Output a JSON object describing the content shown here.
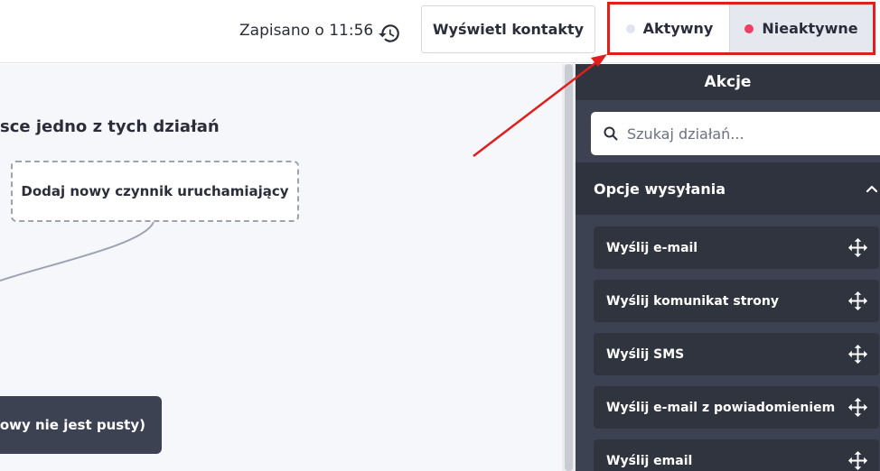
{
  "topbar": {
    "saved_text": "Zapisano o 11:56",
    "history_icon": "history-icon",
    "view_contacts_label": "Wyświetl kontakty",
    "status": {
      "active_label": "Aktywny",
      "inactive_label": "Nieaktywne",
      "selected": "Nieaktywne",
      "active_dot_color": "#e1e3ee",
      "inactive_dot_color": "#ef3e62"
    }
  },
  "canvas": {
    "title": "sce jedno z tych działań",
    "trigger_label": "Dodaj nowy czynnik uruchamiający",
    "condition_label": "ztowy nie jest pusty)"
  },
  "sidebar": {
    "title": "Akcje",
    "search": {
      "placeholder": "Szukaj działań...",
      "icon": "search-icon"
    },
    "section": {
      "title": "Opcje wysyłania",
      "expanded": true
    },
    "actions": [
      {
        "label": "Wyślij e-mail"
      },
      {
        "label": "Wyślij komunikat strony"
      },
      {
        "label": "Wyślij SMS"
      },
      {
        "label": "Wyślij e-mail z powiadomieniem"
      },
      {
        "label": "Wyślij email"
      }
    ]
  },
  "colors": {
    "sidebar_bg": "#3d4252",
    "highlight_red": "#e01e1e"
  }
}
